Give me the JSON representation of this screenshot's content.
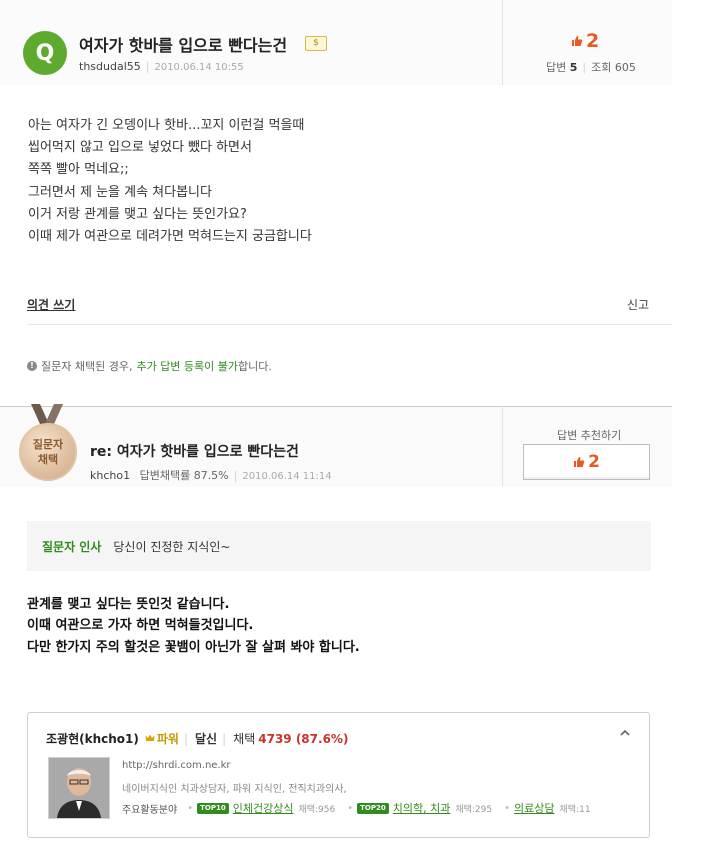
{
  "question": {
    "badge": "Q",
    "title": "여자가 핫바를 입으로 빤다는건",
    "coin_icon": "$",
    "username": "thsdudal55",
    "date": "2010.06.14  10:55",
    "recommend_count": "2",
    "answers_label": "답변",
    "answers_count": "5",
    "views_label": "조회",
    "views_count": "605",
    "body_lines": [
      "아는 여자가 긴 오뎅이나 핫바...꼬지 이런걸 먹을때",
      "씹어먹지 않고 입으로 넣었다 뺐다 하면서",
      "쪽쪽 빨아 먹네요;;",
      "그러면서 제 눈을 계속 쳐다봅니다",
      "이거 저랑 관계를 맺고 싶다는 뜻인가요?",
      "이때 제가 여관으로 데려가면 먹혀드는지 궁금합니다"
    ],
    "comment_link": "의견 쓰기",
    "report_link": "신고"
  },
  "notice": {
    "prefix": "질문자 채택된 경우,",
    "highlight": "추가 답변 등록이 불가",
    "suffix": "합니다."
  },
  "answer": {
    "medal_line1": "질문자",
    "medal_line2": "채택",
    "title": "re: 여자가 핫바를 입으로 빤다는건",
    "username": "khcho1",
    "adopt_rate_label": "답변채택률 87.5%",
    "date": "2010.06.14  11:14",
    "recommend_label": "답변 추천하기",
    "recommend_count": "2",
    "greeting_label": "질문자 인사",
    "greeting_text": "당신이 진정한 지식인~",
    "body_lines": [
      "관계를 맺고 싶다는 뜻인것 같습니다.",
      "이때 여관으로 가자 하면 먹혀들것입니다.",
      "다만 한가지 주의 할것은 꽃뱀이 아닌가 잘 살펴 봐야 합니다."
    ]
  },
  "profile": {
    "name": "조광현(khcho1)",
    "power": "파워",
    "dangsin": "달신",
    "adopt_label": "채택",
    "adopt_value": "4739 (87.6%)",
    "url": "http://shrdi.com.ne.kr",
    "description": "네이버지식인 치과상담자, 파워 지식인, 전직치과의사,",
    "fields_label": "주요활동분야",
    "fields": [
      {
        "badge": "TOP10",
        "name": "인체건강상식",
        "count": "채택:956"
      },
      {
        "badge": "TOP20",
        "name": "치의학, 치과",
        "count": "채택:295"
      },
      {
        "badge": "",
        "name": "의료상담",
        "count": "채택:11"
      }
    ]
  },
  "colors": {
    "accent_orange": "#e85a1f",
    "naver_green": "#318c1e",
    "q_badge_green": "#5daa2f",
    "adopt_red": "#c5352b"
  }
}
